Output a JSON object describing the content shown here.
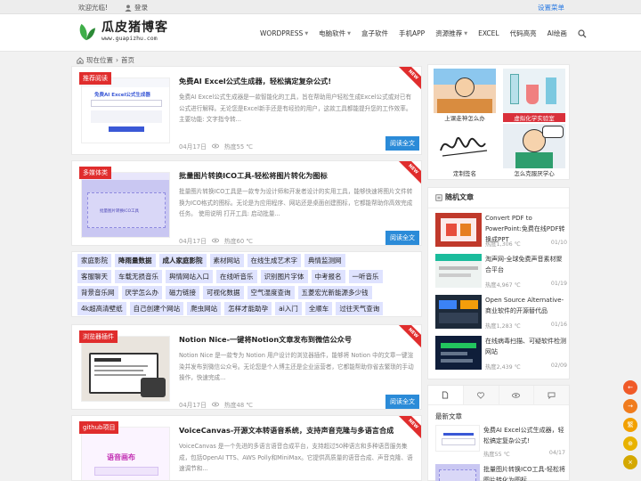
{
  "topbar": {
    "welcome": "欢迎光临!",
    "login": "登录",
    "settings_menu": "设置菜单"
  },
  "logo": {
    "title": "瓜皮猪博客",
    "subtitle": "www.guapizhu.com"
  },
  "nav": {
    "items": [
      {
        "label": "WORDPRESS",
        "dropdown": true
      },
      {
        "label": "电脑软件",
        "dropdown": true
      },
      {
        "label": "盒子软件",
        "dropdown": false
      },
      {
        "label": "手机APP",
        "dropdown": false
      },
      {
        "label": "资源推荐",
        "dropdown": true
      },
      {
        "label": "EXCEL",
        "dropdown": false
      },
      {
        "label": "代码高亮",
        "dropdown": false
      },
      {
        "label": "AI绘画",
        "dropdown": false
      }
    ]
  },
  "breadcrumb": {
    "label": "现在位置",
    "home": "首页"
  },
  "posts": [
    {
      "tag": "推荐阅读",
      "title": "免费AI Excel公式生成器，轻松搞定复杂公式!",
      "excerpt": "免费AI Excel公式生成器是一款智能化的工具，旨在帮助用户轻松生成Excel公式或对已有公式进行解释。无论您是Excel新手还是有经验的用户，这款工具都能提升您的工作效率。 主要功能: 文字指令转...",
      "date": "04月17日",
      "views": "热度55 ℃",
      "more": "阅读全文",
      "new": "NEW",
      "thumb_text": "免费AI Excel公式生成器"
    },
    {
      "tag": "多媒体类",
      "title": "批量图片转换ICO工具-轻松将图片转化为图标",
      "excerpt": "批量图片转换ICO工具是一款专为设计师和开发者设计的实用工具，能够快速将图片文件转换为ICO格式的图标。无论是为应用程序、网站还是桌面创建图标，它都能帮助你高效完成任务。 使用说明 打开工具: 启动批量...",
      "date": "04月17日",
      "views": "热度60 ℃",
      "more": "阅读全文",
      "new": "NEW",
      "thumb_text": "批量图片转换ICO工具"
    },
    {
      "tag": "浏览器插件",
      "title": "Notion Nice-一键将Notion文章发布到微信公众号",
      "excerpt": "Notion Nice 是一款专为 Notion 用户设计的浏览器插件，能够将 Notion 中的文章一键渲染并发布到微信公众号。无论您是个人博主还是企业运营者，它都能帮助你省去繁琐的手动操作，快速完成...",
      "date": "04月17日",
      "views": "热度48 ℃",
      "more": "阅读全文",
      "new": "NEW",
      "thumb_text": ""
    },
    {
      "tag": "github项目",
      "title": "VoiceCanvas-开源文本转语音系统，支持声音克隆与多语言合成",
      "excerpt": "VoiceCanvas 是一个先进的多语言语音合成平台，支持超过50种语言和多种语音服务集成，包括OpenAI TTS、AWS Polly和MiniMax。它提供高质量的语音合成、声音克隆、语速调节和...",
      "date": "",
      "views": "",
      "more": "",
      "new": "NEW",
      "thumb_text": "语音画布"
    }
  ],
  "tags": [
    [
      "家庭影院",
      "降雨量数据",
      "成人家庭影院",
      "素材网站",
      "在线生成艺术字",
      "典情监测网"
    ],
    [
      "客服聊天",
      "车载无损音乐",
      "舆情网站入口",
      "在线听音乐",
      "识别图片字体",
      "中考报名",
      "一听音乐"
    ],
    [
      "背景音乐网",
      "厌学怎么办",
      "磁力链接",
      "可视化数据",
      "空气湿度查询",
      "五菱宏光新能源多少钱"
    ],
    [
      "4k超高清壁纸",
      "自己创建个网站",
      "爬虫网站",
      "怎样才能助孕",
      "ai入门",
      "全顺车",
      "过往天气查询"
    ]
  ],
  "sidebar_images": [
    {
      "caption": "上课走神怎么办"
    },
    {
      "caption": "虚拟化学实验室"
    },
    {
      "caption": "定制签名"
    },
    {
      "caption": "怎么克服厌学心"
    }
  ],
  "random": {
    "title": "随机文章",
    "items": [
      {
        "title": "Convert PDF to PowerPoint:免费在线PDF转换成PPT",
        "views": "热度1,306 ℃",
        "date": "01/10"
      },
      {
        "title": "淘声网-全球免费声音素材聚合平台",
        "views": "热度4,967 ℃",
        "date": "01/19"
      },
      {
        "title": "Open Source Alternative-商业软件的开源替代品",
        "views": "热度1,283 ℃",
        "date": "01/16"
      },
      {
        "title": "在线病毒扫描、可疑软件检测网站",
        "views": "热度2,439 ℃",
        "date": "02/09"
      }
    ]
  },
  "latest": {
    "title": "最新文章",
    "items": [
      {
        "title": "免费AI Excel公式生成器，轻松搞定复杂公式!",
        "views": "热度55 ℃",
        "date": "04/17"
      },
      {
        "title": "批量图片转换ICO工具-轻松将图片转化为图标",
        "views": "",
        "date": ""
      }
    ]
  },
  "float_buttons": [
    "←",
    "→",
    "繁",
    "⊕",
    "×"
  ],
  "colors": {
    "accent": "#2b8bd8",
    "tag_red": "#e02d2d",
    "tag_bg": "#dfe3ff",
    "float": [
      "#f05a28",
      "#f07c1e",
      "#f2a000",
      "#e8b200",
      "#d4a800"
    ]
  }
}
